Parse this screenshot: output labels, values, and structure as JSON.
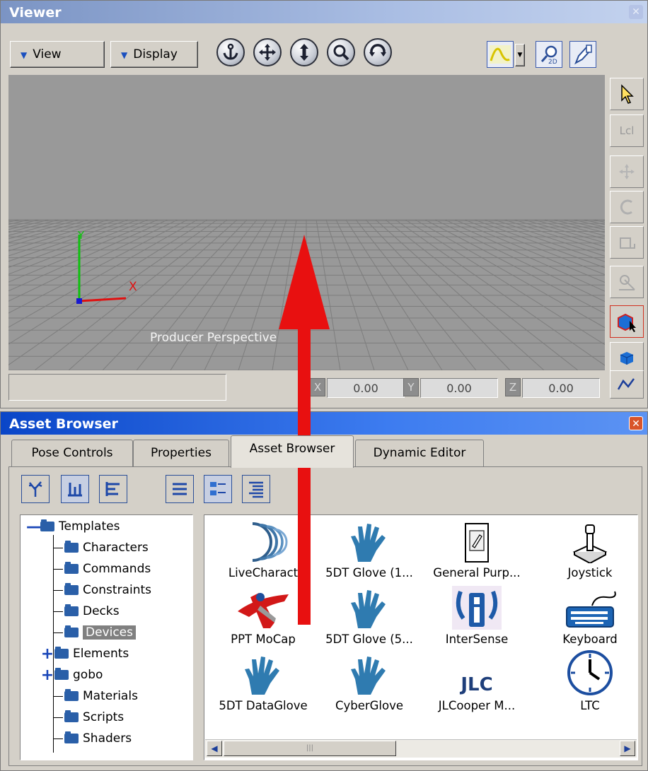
{
  "viewer": {
    "title": "Viewer",
    "view_label": "View",
    "display_label": "Display",
    "nav_icons": [
      "anchor-icon",
      "move-icon",
      "vertical-move-icon",
      "zoom-icon",
      "rotate-icon"
    ],
    "right_tools": [
      "curve-icon",
      "zoom-2d-icon",
      "pen-settings-icon"
    ],
    "side_tools": [
      "select-arrow-icon",
      "local-icon",
      "translate-icon",
      "rotate-icon",
      "scale-icon",
      "manipulator-icon",
      "object-select-icon",
      "cube-icon",
      "curve-icon"
    ],
    "local_label": "Lcl",
    "camera_label": "Producer Perspective",
    "axis_x": "X",
    "axis_y": "Y",
    "coords": {
      "x_label": "X",
      "x_value": "0.00",
      "y_label": "Y",
      "y_value": "0.00",
      "z_label": "Z",
      "z_value": "0.00"
    }
  },
  "asset_browser": {
    "title": "Asset Browser",
    "tabs": [
      {
        "label": "Pose Controls"
      },
      {
        "label": "Properties"
      },
      {
        "label": "Asset Browser"
      },
      {
        "label": "Dynamic Editor"
      }
    ],
    "active_tab": "Asset Browser",
    "tree": [
      {
        "label": "Templates",
        "expander": "—"
      },
      {
        "label": "Characters"
      },
      {
        "label": "Commands"
      },
      {
        "label": "Constraints"
      },
      {
        "label": "Decks"
      },
      {
        "label": "Devices",
        "selected": true
      },
      {
        "label": "Elements",
        "expander": "+"
      },
      {
        "label": "gobo",
        "expander": "+"
      },
      {
        "label": "Materials"
      },
      {
        "label": "Scripts"
      },
      {
        "label": "Shaders"
      }
    ],
    "assets": [
      {
        "label": "LiveCharact",
        "icon": "live-character-icon"
      },
      {
        "label": "5DT Glove (1...",
        "icon": "glove-icon"
      },
      {
        "label": "General Purp...",
        "icon": "general-purpose-device-icon"
      },
      {
        "label": "Joystick",
        "icon": "joystick-icon"
      },
      {
        "label": "PPT MoCap",
        "icon": "ppt-mocap-icon"
      },
      {
        "label": "5DT Glove (5...",
        "icon": "glove-icon"
      },
      {
        "label": "InterSense",
        "icon": "intersense-icon"
      },
      {
        "label": "Keyboard",
        "icon": "keyboard-icon"
      },
      {
        "label": "5DT DataGlove",
        "icon": "glove-icon"
      },
      {
        "label": "CyberGlove",
        "icon": "glove-icon"
      },
      {
        "label": "JLCooper M...",
        "icon": "jlc-icon"
      },
      {
        "label": "LTC",
        "icon": "clock-icon"
      }
    ],
    "jlc_text": "JLC",
    "scroll_grip": "|||"
  },
  "colors": {
    "arrow": "#e81010",
    "viewport": "#999999",
    "glove": "#2f7bb0",
    "title_active": "#0a46c8"
  }
}
